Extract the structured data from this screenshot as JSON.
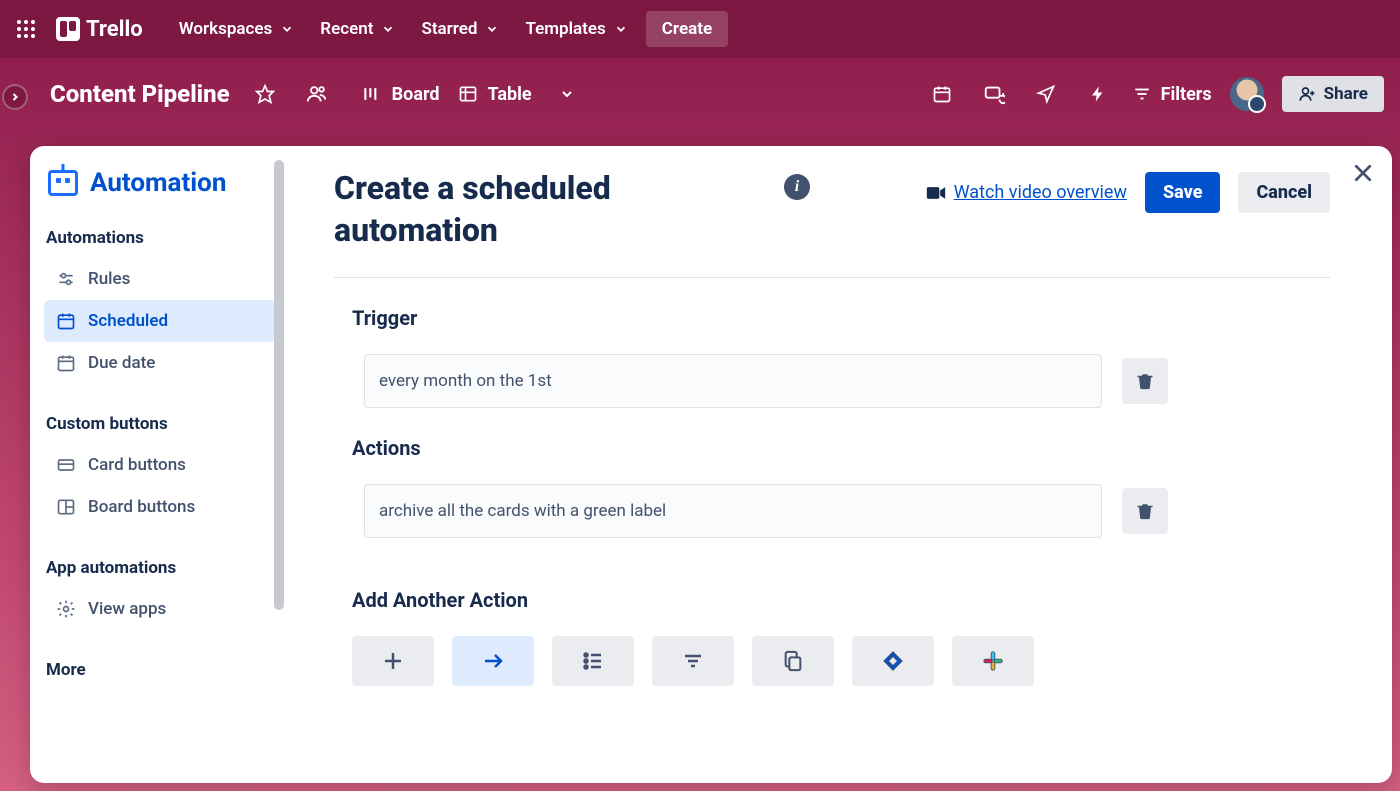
{
  "topnav": {
    "brand": "Trello",
    "menu": [
      "Workspaces",
      "Recent",
      "Starred",
      "Templates"
    ],
    "create": "Create"
  },
  "boardbar": {
    "title": "Content Pipeline",
    "views": {
      "board": "Board",
      "table": "Table"
    },
    "filters": "Filters",
    "share": "Share"
  },
  "sidebar": {
    "title": "Automation",
    "groups": [
      {
        "heading": "Automations",
        "items": [
          "Rules",
          "Scheduled",
          "Due date"
        ],
        "activeIndex": 1
      },
      {
        "heading": "Custom buttons",
        "items": [
          "Card buttons",
          "Board buttons"
        ]
      },
      {
        "heading": "App automations",
        "items": [
          "View apps"
        ]
      },
      {
        "heading": "More",
        "items": []
      }
    ]
  },
  "main": {
    "title": "Create a scheduled automation",
    "video_link": "Watch video overview",
    "save": "Save",
    "cancel": "Cancel",
    "sections": {
      "trigger": {
        "heading": "Trigger",
        "text": "every month on the 1st"
      },
      "actions": {
        "heading": "Actions",
        "text": "archive all the cards with a green label"
      },
      "add_another": "Add Another Action"
    }
  }
}
